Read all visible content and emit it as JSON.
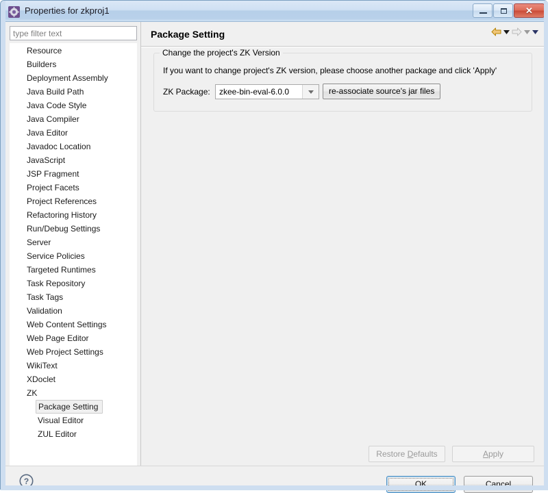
{
  "window": {
    "title": "Properties for zkproj1",
    "icon": "properties-gear-icon",
    "minimize_label": "Minimize",
    "maximize_label": "Maximize",
    "close_label": "✕"
  },
  "filter": {
    "placeholder": "type filter text",
    "value": ""
  },
  "tree": {
    "items": [
      {
        "label": "Resource",
        "level": 0,
        "selected": false
      },
      {
        "label": "Builders",
        "level": 0,
        "selected": false
      },
      {
        "label": "Deployment Assembly",
        "level": 0,
        "selected": false
      },
      {
        "label": "Java Build Path",
        "level": 0,
        "selected": false
      },
      {
        "label": "Java Code Style",
        "level": 0,
        "selected": false
      },
      {
        "label": "Java Compiler",
        "level": 0,
        "selected": false
      },
      {
        "label": "Java Editor",
        "level": 0,
        "selected": false
      },
      {
        "label": "Javadoc Location",
        "level": 0,
        "selected": false
      },
      {
        "label": "JavaScript",
        "level": 0,
        "selected": false
      },
      {
        "label": "JSP Fragment",
        "level": 0,
        "selected": false
      },
      {
        "label": "Project Facets",
        "level": 0,
        "selected": false
      },
      {
        "label": "Project References",
        "level": 0,
        "selected": false
      },
      {
        "label": "Refactoring History",
        "level": 0,
        "selected": false
      },
      {
        "label": "Run/Debug Settings",
        "level": 0,
        "selected": false
      },
      {
        "label": "Server",
        "level": 0,
        "selected": false
      },
      {
        "label": "Service Policies",
        "level": 0,
        "selected": false
      },
      {
        "label": "Targeted Runtimes",
        "level": 0,
        "selected": false
      },
      {
        "label": "Task Repository",
        "level": 0,
        "selected": false
      },
      {
        "label": "Task Tags",
        "level": 0,
        "selected": false
      },
      {
        "label": "Validation",
        "level": 0,
        "selected": false
      },
      {
        "label": "Web Content Settings",
        "level": 0,
        "selected": false
      },
      {
        "label": "Web Page Editor",
        "level": 0,
        "selected": false
      },
      {
        "label": "Web Project Settings",
        "level": 0,
        "selected": false
      },
      {
        "label": "WikiText",
        "level": 0,
        "selected": false
      },
      {
        "label": "XDoclet",
        "level": 0,
        "selected": false
      },
      {
        "label": "ZK",
        "level": 0,
        "selected": false
      },
      {
        "label": "Package Setting",
        "level": 1,
        "selected": true
      },
      {
        "label": "Visual Editor",
        "level": 1,
        "selected": false
      },
      {
        "label": "ZUL Editor",
        "level": 1,
        "selected": false
      }
    ]
  },
  "page": {
    "title": "Package Setting",
    "nav": {
      "back_icon": "back-arrow-icon",
      "back_menu_icon": "chevron-down-icon",
      "forward_icon": "forward-arrow-icon",
      "forward_menu_icon": "chevron-down-icon",
      "view_menu_icon": "chevron-down-icon"
    },
    "group": {
      "legend": "Change the project's ZK Version",
      "description": "If you want to change project's ZK version, please choose another package and click 'Apply'",
      "package_label": "ZK Package:",
      "package_value": "zkee-bin-eval-6.0.0",
      "package_options": [
        "zkee-bin-eval-6.0.0"
      ],
      "reassociate_button": "re-associate source's jar files",
      "dropdown_icon": "chevron-down-icon"
    }
  },
  "page_buttons": {
    "restore_defaults_pre": "Restore ",
    "restore_defaults_mnemonic": "D",
    "restore_defaults_post": "efaults",
    "apply_mnemonic": "A",
    "apply_post": "pply"
  },
  "footer": {
    "help_icon": "help-question-icon",
    "ok_label": "OK",
    "cancel_label": "Cancel"
  },
  "colors": {
    "titlebar": "#c6daee",
    "close_button": "#c94a37",
    "panel_bg": "#f0f0f0",
    "tree_bg": "#ffffff",
    "back_arrow": "#e8a317",
    "forward_arrow": "#d8d8d8",
    "focus_ring": "#4f90c4",
    "disabled_text": "#9a9a9a"
  }
}
